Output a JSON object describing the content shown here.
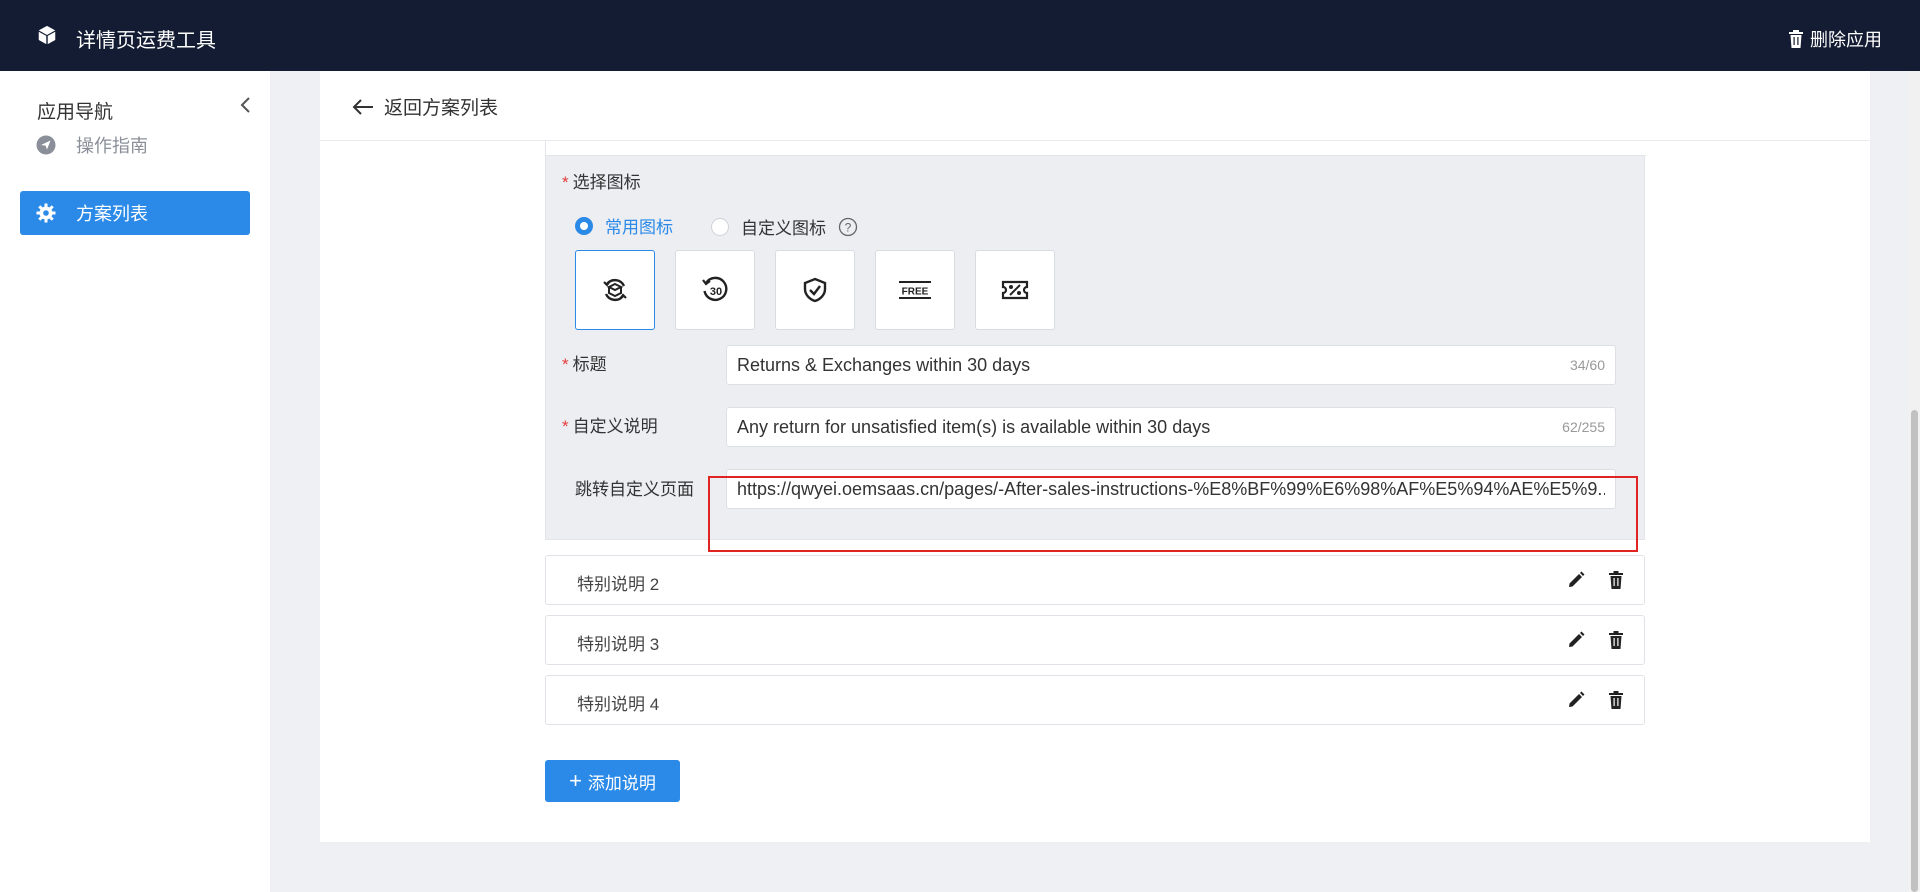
{
  "topbar": {
    "app_title": "详情页运费工具",
    "delete_label": "删除应用",
    "logo_icon": "cube-icon",
    "delete_icon": "trash-icon"
  },
  "sidebar": {
    "title": "应用导航",
    "items": [
      {
        "label": "操作指南",
        "icon": "compass-icon",
        "active": false
      },
      {
        "label": "方案列表",
        "icon": "gear-icon",
        "active": true
      }
    ]
  },
  "header": {
    "back_label": "返回方案列表"
  },
  "form": {
    "icon_section_label": "选择图标",
    "radio_common": "常用图标",
    "radio_custom": "自定义图标",
    "selected_radio": "常用图标",
    "icon_options": [
      "return-exchange-icon",
      "30-days-icon",
      "shield-check-icon",
      "free-icon",
      "discount-ticket-icon"
    ],
    "selected_icon": "return-exchange-icon",
    "title_label": "标题",
    "title_value": "Returns & Exchanges within 30 days",
    "title_count": "34/60",
    "desc_label": "自定义说明",
    "desc_value": "Any return for unsatisfied item(s) is available within 30 days",
    "desc_count": "62/255",
    "link_label": "跳转自定义页面",
    "link_value": "https://qwyei.oemsaas.cn/pages/-After-sales-instructions-%E8%BF%99%E6%98%AF%E5%94%AE%E5%9..."
  },
  "notes": [
    {
      "label": "特别说明 2"
    },
    {
      "label": "特别说明 3"
    },
    {
      "label": "特别说明 4"
    }
  ],
  "add_button": {
    "label": "添加说明",
    "prefix": "+"
  },
  "colors": {
    "accent": "#2b8ae8",
    "topbar": "#141c33",
    "required": "#e23c3c",
    "highlight": "#e02424"
  }
}
